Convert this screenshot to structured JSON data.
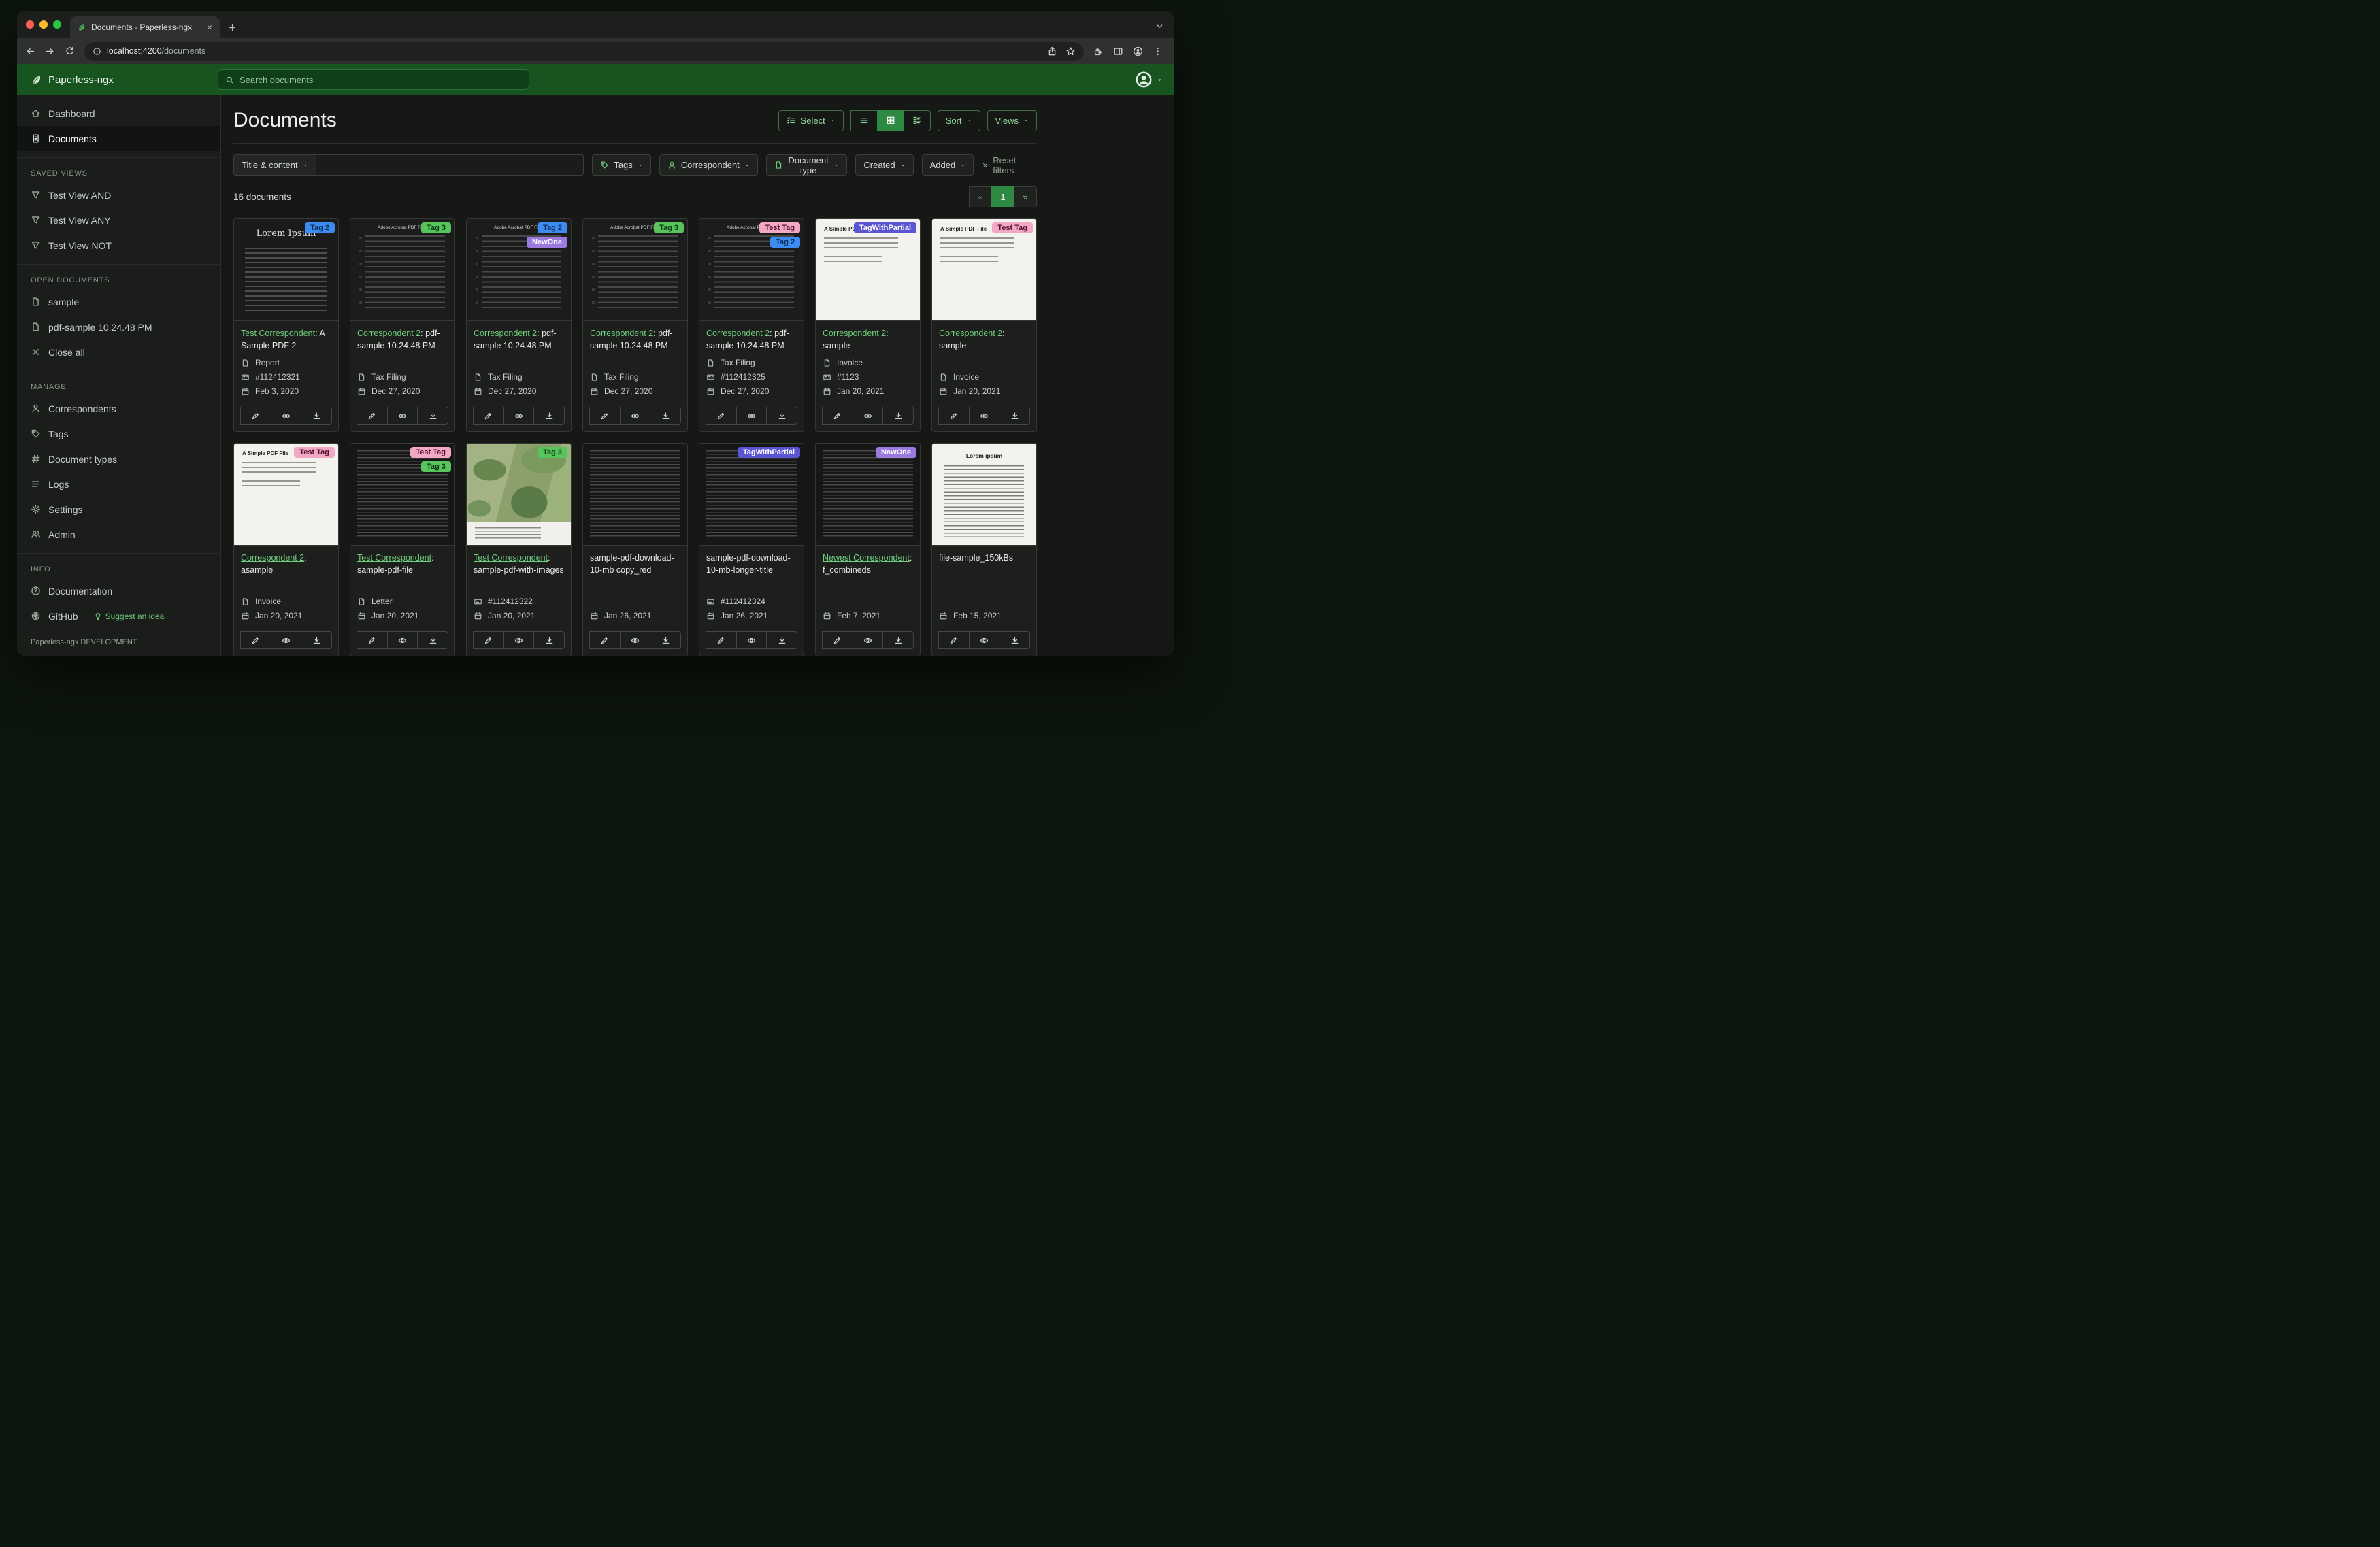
{
  "browser": {
    "tab_title": "Documents - Paperless-ngx",
    "url_host": "localhost:4200",
    "url_path": "/documents",
    "nav_icons": [
      {
        "icon": "back-icon"
      },
      {
        "icon": "forward-icon"
      },
      {
        "icon": "reload-icon"
      }
    ],
    "pill_icons": [
      {
        "icon": "share-icon"
      },
      {
        "icon": "star-icon"
      }
    ],
    "right_icons": [
      {
        "icon": "puzzle-icon"
      },
      {
        "icon": "panel-icon"
      },
      {
        "icon": "avatar-icon"
      },
      {
        "icon": "kebab-icon"
      }
    ]
  },
  "icons": {
    "favicon": "leaf-icon",
    "tab_close": "close-icon",
    "new_tab": "plus-icon",
    "tab_search": "chevron-down-icon",
    "url_info": "info-icon",
    "brand": "leaf-icon",
    "search": "search-icon",
    "user_avatar": "avatar-icon",
    "caret": "caret-down-icon",
    "select": "select-icon",
    "reset": "close-icon",
    "doc_type_meta": "doctype-icon",
    "asn_meta": "asn-icon",
    "date_meta": "calendar-icon"
  },
  "app_header": {
    "brand": "Paperless-ngx",
    "search_placeholder": "Search documents"
  },
  "sidebar": {
    "primary": [
      {
        "label": "Dashboard",
        "icon": "dashboard-icon",
        "state": ""
      },
      {
        "label": "Documents",
        "icon": "documents-icon",
        "state": "active"
      }
    ],
    "sections": [
      {
        "title": "SAVED VIEWS",
        "items": [
          {
            "label": "Test View AND",
            "icon": "filter-icon"
          },
          {
            "label": "Test View ANY",
            "icon": "filter-icon"
          },
          {
            "label": "Test View NOT",
            "icon": "filter-icon"
          }
        ]
      },
      {
        "title": "OPEN DOCUMENTS",
        "items": [
          {
            "label": "sample",
            "icon": "file-icon"
          },
          {
            "label": "pdf-sample 10.24.48 PM",
            "icon": "file-icon"
          },
          {
            "label": "Close all",
            "icon": "close-icon"
          }
        ]
      },
      {
        "title": "MANAGE",
        "items": [
          {
            "label": "Correspondents",
            "icon": "person-icon"
          },
          {
            "label": "Tags",
            "icon": "tag-icon"
          },
          {
            "label": "Document types",
            "icon": "hash-icon"
          },
          {
            "label": "Logs",
            "icon": "logs-icon"
          },
          {
            "label": "Settings",
            "icon": "gear-icon"
          },
          {
            "label": "Admin",
            "icon": "users-icon"
          }
        ]
      },
      {
        "title": "INFO",
        "items": [
          {
            "label": "Documentation",
            "icon": "question-icon"
          },
          {
            "label": "GitHub",
            "icon": "github-icon",
            "extra": "Suggest an idea",
            "extra_icon": "bulb-icon"
          }
        ]
      }
    ],
    "footer": "Paperless-ngx DEVELOPMENT"
  },
  "main": {
    "title": "Documents",
    "toolbar": {
      "select_label": "Select",
      "view_toggles": [
        {
          "icon": "list-view-icon",
          "state": ""
        },
        {
          "icon": "grid-view-icon",
          "state": "active"
        },
        {
          "icon": "details-view-icon",
          "state": ""
        }
      ],
      "sort_label": "Sort",
      "views_label": "Views"
    },
    "filters": {
      "field_selector": "Title & content",
      "buttons": [
        {
          "label": "Tags",
          "icon": "tag-icon"
        },
        {
          "label": "Correspondent",
          "icon": "person-icon"
        },
        {
          "label": "Document type",
          "icon": "doctype-icon"
        },
        {
          "label": "Created",
          "icon": ""
        },
        {
          "label": "Added",
          "icon": ""
        }
      ],
      "reset_label": "Reset filters"
    },
    "count_label": "16 documents",
    "pagination": [
      {
        "label": "«",
        "state": "disabled"
      },
      {
        "label": "1",
        "state": "active"
      },
      {
        "label": "»",
        "state": ""
      }
    ]
  },
  "card_actions": [
    {
      "icon": "edit-icon"
    },
    {
      "icon": "view-icon"
    },
    {
      "icon": "download-icon"
    }
  ],
  "colors": {
    "header_green": "#17541f",
    "accent_green": "#6cc578",
    "active_green": "#2e8a42",
    "tag_blue": "#3d8bf0",
    "tag_green": "#57c45c",
    "tag_pink": "#f2a7c3",
    "tag_purple": "#9b7ae0",
    "tag_indigo": "#5a55d2"
  },
  "cards": [
    {
      "thumb_class": "thumb lorem-dark",
      "thumb_text": "Lorem Ipsum",
      "tags": [
        {
          "label": "Tag 2",
          "bg": "#3d8bf0",
          "fg": "#072c55"
        }
      ],
      "correspondent": "Test Correspondent",
      "title_rest": ": A Sample PDF 2",
      "doc_type": "Report",
      "asn": "#112412321",
      "date": "Feb 3, 2020"
    },
    {
      "thumb_class": "thumb adobe-dark",
      "thumb_text": "Adobe Acrobat PDF Files",
      "tags": [
        {
          "label": "Tag 3",
          "bg": "#57c45c",
          "fg": "#0b3a10"
        }
      ],
      "correspondent": "Correspondent 2",
      "title_rest": ": pdf-sample 10.24.48 PM",
      "doc_type": "Tax Filing",
      "asn": null,
      "date": "Dec 27, 2020"
    },
    {
      "thumb_class": "thumb adobe-dark",
      "thumb_text": "Adobe Acrobat PDF Files",
      "tags": [
        {
          "label": "Tag 2",
          "bg": "#3d8bf0",
          "fg": "#072c55"
        },
        {
          "label": "NewOne",
          "bg": "#9b7ae0",
          "fg": "#ffffff"
        }
      ],
      "correspondent": "Correspondent 2",
      "title_rest": ": pdf-sample 10.24.48 PM",
      "doc_type": "Tax Filing",
      "asn": null,
      "date": "Dec 27, 2020"
    },
    {
      "thumb_class": "thumb adobe-dark",
      "thumb_text": "Adobe Acrobat PDF Files",
      "tags": [
        {
          "label": "Tag 3",
          "bg": "#57c45c",
          "fg": "#0b3a10"
        }
      ],
      "correspondent": "Correspondent 2",
      "title_rest": ": pdf-sample 10.24.48 PM",
      "doc_type": "Tax Filing",
      "asn": null,
      "date": "Dec 27, 2020"
    },
    {
      "thumb_class": "thumb adobe-dark",
      "thumb_text": "Adobe Acrobat PDF Files",
      "tags": [
        {
          "label": "Test Tag",
          "bg": "#f2a7c3",
          "fg": "#571230"
        },
        {
          "label": "Tag 2",
          "bg": "#3d8bf0",
          "fg": "#072c55"
        }
      ],
      "correspondent": "Correspondent 2",
      "title_rest": ": pdf-sample 10.24.48 PM",
      "doc_type": "Tax Filing",
      "asn": "#112412325",
      "date": "Dec 27, 2020"
    },
    {
      "thumb_class": "thumb simple-light",
      "thumb_text": "A Simple PDF File",
      "tags": [
        {
          "label": "TagWithPartial",
          "bg": "#5a55d2",
          "fg": "#ffffff"
        }
      ],
      "correspondent": "Correspondent 2",
      "title_rest": ": sample",
      "doc_type": "Invoice",
      "asn": "#1123",
      "date": "Jan 20, 2021"
    },
    {
      "thumb_class": "thumb simple-light",
      "thumb_text": "A Simple PDF File",
      "tags": [
        {
          "label": "Test Tag",
          "bg": "#f2a7c3",
          "fg": "#571230"
        }
      ],
      "correspondent": "Correspondent 2",
      "title_rest": ": sample",
      "doc_type": "Invoice",
      "asn": null,
      "date": "Jan 20, 2021"
    },
    {
      "thumb_class": "thumb simple-light",
      "thumb_text": "A Simple PDF File",
      "tags": [
        {
          "label": "Test Tag",
          "bg": "#f2a7c3",
          "fg": "#571230"
        }
      ],
      "correspondent": "Correspondent 2",
      "title_rest": ": asample",
      "doc_type": "Invoice",
      "asn": null,
      "date": "Jan 20, 2021"
    },
    {
      "thumb_class": "thumb dense-dark",
      "thumb_text": "",
      "tags": [
        {
          "label": "Test Tag",
          "bg": "#f2a7c3",
          "fg": "#571230"
        },
        {
          "label": "Tag 3",
          "bg": "#57c45c",
          "fg": "#0b3a10"
        }
      ],
      "correspondent": "Test Correspondent",
      "title_rest": ": sample-pdf-file",
      "doc_type": "Letter",
      "asn": null,
      "date": "Jan 20, 2021"
    },
    {
      "thumb_class": "thumb map",
      "thumb_text": "",
      "tags": [
        {
          "label": "Tag 3",
          "bg": "#57c45c",
          "fg": "#0b3a10"
        }
      ],
      "correspondent": "Test Correspondent",
      "title_rest": ": sample-pdf-with-images",
      "doc_type": null,
      "asn": "#112412322",
      "date": "Jan 20, 2021"
    },
    {
      "thumb_class": "thumb dense-dark",
      "thumb_text": "",
      "tags": [],
      "correspondent": null,
      "title_rest": "sample-pdf-download-10-mb copy_red",
      "doc_type": null,
      "asn": null,
      "date": "Jan 26, 2021"
    },
    {
      "thumb_class": "thumb dense-dark",
      "thumb_text": "",
      "tags": [
        {
          "label": "TagWithPartial",
          "bg": "#5a55d2",
          "fg": "#ffffff"
        }
      ],
      "correspondent": null,
      "title_rest": "sample-pdf-download-10-mb-longer-title",
      "doc_type": null,
      "asn": "#112412324",
      "date": "Jan 26, 2021"
    },
    {
      "thumb_class": "thumb dense-dark",
      "thumb_text": "",
      "tags": [
        {
          "label": "NewOne",
          "bg": "#9b7ae0",
          "fg": "#ffffff"
        }
      ],
      "correspondent": "Newest Correspondent",
      "title_rest": ": f_combineds",
      "doc_type": null,
      "asn": null,
      "date": "Feb 7, 2021"
    },
    {
      "thumb_class": "thumb lorem-light",
      "thumb_text": "Lorem ipsum",
      "tags": [],
      "correspondent": null,
      "title_rest": "file-sample_150kBs",
      "doc_type": null,
      "asn": null,
      "date": "Feb 15, 2021"
    }
  ]
}
